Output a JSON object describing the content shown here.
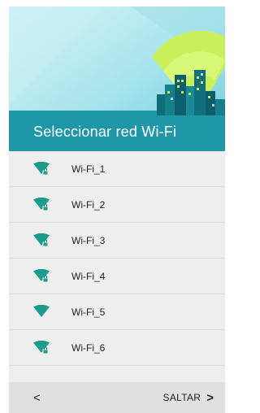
{
  "header": {
    "title": "Seleccionar red Wi-Fi"
  },
  "colors": {
    "header_top": "#b9e8ef",
    "header_teal": "#1f97a8",
    "accent_yellow": "#c9f05a",
    "wifi_icon": "#1d9c8d"
  },
  "networks": [
    {
      "ssid": "Wi-Fi_1",
      "secured": true
    },
    {
      "ssid": "Wi-Fi_2",
      "secured": true
    },
    {
      "ssid": "Wi-Fi_3",
      "secured": true
    },
    {
      "ssid": "Wi-Fi_4",
      "secured": true
    },
    {
      "ssid": "Wi-Fi_5",
      "secured": false
    },
    {
      "ssid": "Wi-Fi_6",
      "secured": true
    }
  ],
  "footer": {
    "back_label": "<",
    "skip_label": "SALTAR",
    "skip_chevron": ">"
  }
}
